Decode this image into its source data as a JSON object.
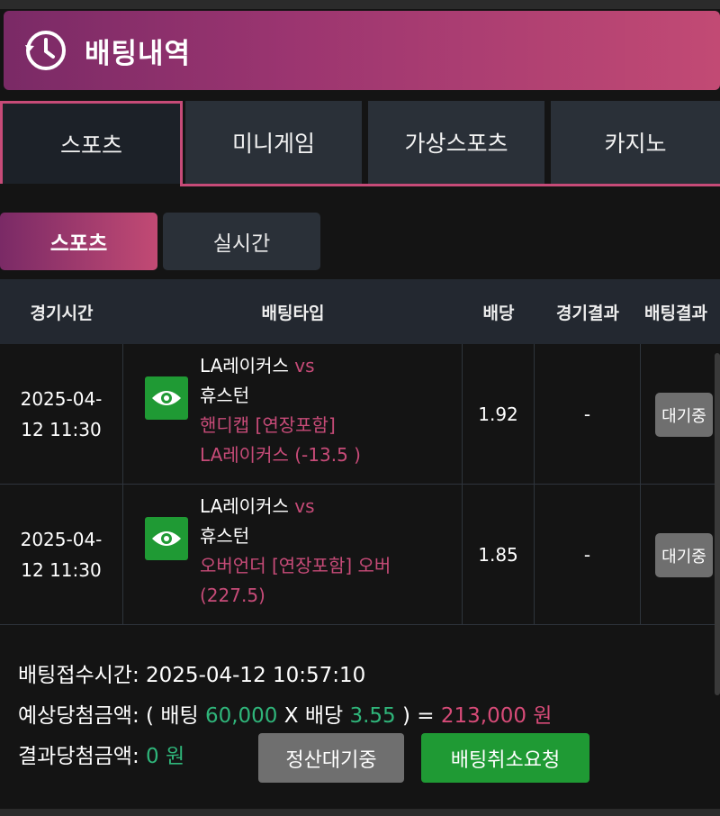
{
  "header": {
    "title": "배팅내역",
    "icon": "history-clock-icon"
  },
  "tabs": [
    {
      "label": "스포츠",
      "active": true
    },
    {
      "label": "미니게임",
      "active": false
    },
    {
      "label": "가상스포츠",
      "active": false
    },
    {
      "label": "카지노",
      "active": false
    }
  ],
  "subtabs": [
    {
      "label": "스포츠",
      "active": true
    },
    {
      "label": "실시간",
      "active": false
    }
  ],
  "table": {
    "columns": [
      "경기시간",
      "배팅타입",
      "배당",
      "경기결과",
      "배팅결과"
    ],
    "rows": [
      {
        "time_date": "2025-04-",
        "time_rest": "12 11:30",
        "team_home": "LA레이커스",
        "vs": "vs",
        "team_away": "휴스턴",
        "bet_type": "핸디캡 [연장포함]",
        "pick": "LA레이커스 (-13.5 )",
        "odds": "1.92",
        "game_result": "-",
        "bet_result": "대기중"
      },
      {
        "time_date": "2025-04-",
        "time_rest": "12 11:30",
        "team_home": "LA레이커스",
        "vs": "vs",
        "team_away": "휴스턴",
        "bet_type": "오버언더 [연장포함] 오버",
        "pick": "(227.5)",
        "odds": "1.85",
        "game_result": "-",
        "bet_result": "대기중"
      }
    ]
  },
  "summary": {
    "received_label": "배팅접수시간:",
    "received_time": "2025-04-12 10:57:10",
    "expected_label": "예상당첨금액:",
    "open_paren": "( 배팅",
    "bet_amount": "60,000",
    "times_label": "X 배당",
    "total_odds": "3.55",
    "equals": ") =",
    "expected_win": "213,000 원",
    "result_label": "결과당첨금액:",
    "result_amount": "0 원",
    "settle_button": "정산대기중",
    "cancel_button": "배팅취소요청"
  },
  "colors": {
    "accent_pink": "#c74b78",
    "green": "#1f9a34",
    "amount_green": "#2fb57a"
  }
}
